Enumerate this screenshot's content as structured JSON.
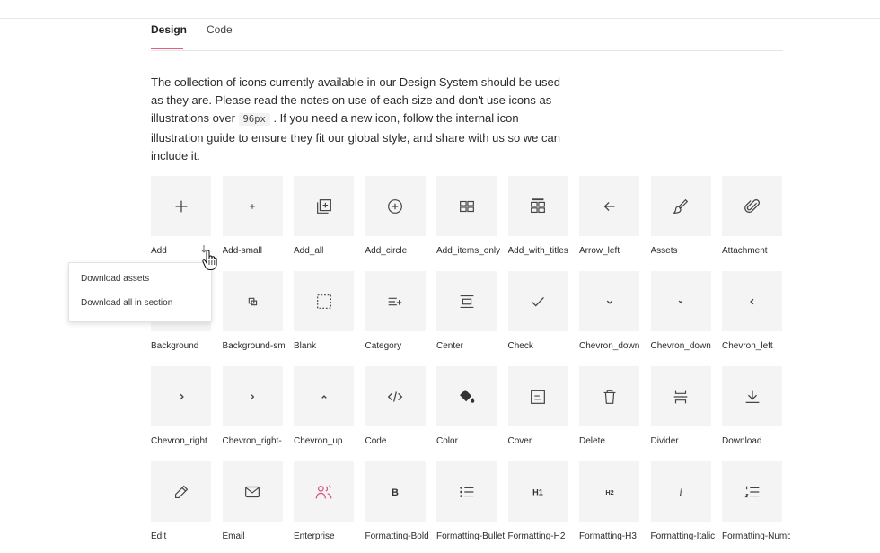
{
  "tabs": [
    {
      "label": "Design",
      "active": true
    },
    {
      "label": "Code",
      "active": false
    }
  ],
  "description": {
    "part1": "The collection of icons currently available in our Design System should be used as they are. Please read the notes on use of each size and don't use icons as illustrations over ",
    "code": "96px",
    "part2": " . If you need a new icon, follow the internal icon illustration guide to ensure they fit our global style, and share with us so we can include it."
  },
  "popover": {
    "items": [
      "Download assets",
      "Download all in section"
    ]
  },
  "icons": [
    {
      "label": "Add",
      "icon": "plus-icon"
    },
    {
      "label": "Add-small",
      "icon": "plus-small-icon"
    },
    {
      "label": "Add_all",
      "icon": "add-all-icon"
    },
    {
      "label": "Add_circle",
      "icon": "add-circle-icon"
    },
    {
      "label": "Add_items_only",
      "icon": "add-items-icon"
    },
    {
      "label": "Add_with_titles",
      "icon": "add-with-titles-icon"
    },
    {
      "label": "Arrow_left",
      "icon": "arrow-left-icon"
    },
    {
      "label": "Assets",
      "icon": "brush-icon"
    },
    {
      "label": "Attachment",
      "icon": "paperclip-icon"
    },
    {
      "label": "Background",
      "icon": "background-icon"
    },
    {
      "label": "Background-sm",
      "icon": "background-small-icon"
    },
    {
      "label": "Blank",
      "icon": "blank-icon"
    },
    {
      "label": "Category",
      "icon": "category-icon"
    },
    {
      "label": "Center",
      "icon": "center-icon"
    },
    {
      "label": "Check",
      "icon": "check-icon"
    },
    {
      "label": "Chevron_down",
      "icon": "chevron-down-icon"
    },
    {
      "label": "Chevron_down",
      "icon": "chevron-down-small-icon"
    },
    {
      "label": "Chevron_left",
      "icon": "chevron-left-icon"
    },
    {
      "label": "Chevron_right",
      "icon": "chevron-right-icon"
    },
    {
      "label": "Chevron_right-",
      "icon": "chevron-right-small-icon"
    },
    {
      "label": "Chevron_up",
      "icon": "chevron-up-icon"
    },
    {
      "label": "Code",
      "icon": "code-icon"
    },
    {
      "label": "Color",
      "icon": "paint-bucket-icon"
    },
    {
      "label": "Cover",
      "icon": "cover-icon"
    },
    {
      "label": "Delete",
      "icon": "trash-icon"
    },
    {
      "label": "Divider",
      "icon": "divider-icon"
    },
    {
      "label": "Download",
      "icon": "download-icon"
    },
    {
      "label": "Edit",
      "icon": "pencil-icon"
    },
    {
      "label": "Email",
      "icon": "envelope-icon"
    },
    {
      "label": "Enterprise",
      "icon": "people-icon"
    },
    {
      "label": "Formatting-Bold",
      "icon": "bold-icon"
    },
    {
      "label": "Formatting-Bullet",
      "icon": "bullet-list-icon"
    },
    {
      "label": "Formatting-H2",
      "icon": "heading-2-icon"
    },
    {
      "label": "Formatting-H3",
      "icon": "heading-3-icon"
    },
    {
      "label": "Formatting-Italic",
      "icon": "italic-icon"
    },
    {
      "label": "Formatting-Numbered",
      "icon": "numbered-list-icon"
    }
  ],
  "icon_texts": {
    "bold": "B",
    "h2": "H1",
    "h3": "H2",
    "italic": "i"
  },
  "colors": {
    "accent": "#e0607e",
    "enterprise": "#d6517a",
    "tile_bg": "#f4f4f4"
  }
}
